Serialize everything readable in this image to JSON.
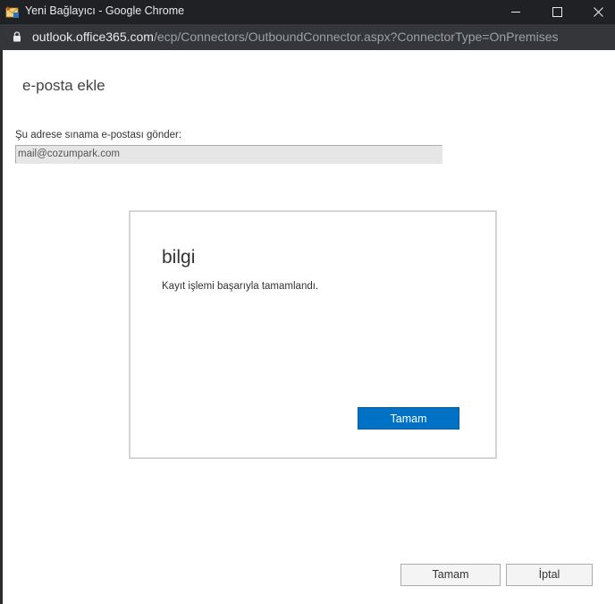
{
  "window": {
    "title": "Yeni Bağlayıcı - Google Chrome"
  },
  "address_bar": {
    "host": "outlook.office365.com",
    "path": "/ecp/Connectors/OutboundConnector.aspx?ConnectorType=OnPremises"
  },
  "page": {
    "title": "e-posta ekle",
    "field_label": "Şu adrese sınama e-postası gönder:",
    "field_value": "mail@cozumpark.com"
  },
  "dialog": {
    "title": "bilgi",
    "message": "Kayıt işlemi başarıyla tamamlandı.",
    "ok_label": "Tamam"
  },
  "footer": {
    "ok_label": "Tamam",
    "cancel_label": "İptal"
  },
  "colors": {
    "title_bar": "#202124",
    "address_bar": "#35363a",
    "primary_button": "#0072c6"
  }
}
